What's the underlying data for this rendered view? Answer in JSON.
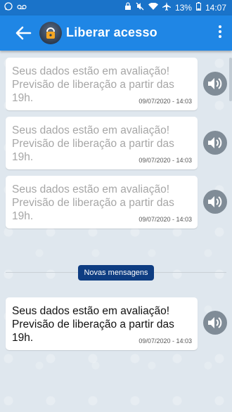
{
  "status_bar": {
    "battery": "13%",
    "time": "14:07"
  },
  "app_bar": {
    "title": "Liberar acesso"
  },
  "messages": [
    {
      "text": "Seus dados estão em avaliação! Previsão de liberação a partir das 19h.",
      "timestamp": "09/07/2020 - 14:03",
      "read": true
    },
    {
      "text": "Seus dados estão em avaliação! Previsão de liberação a partir das 19h.",
      "timestamp": "09/07/2020 - 14:03",
      "read": true
    },
    {
      "text": "Seus dados estão em avaliação! Previsão de liberação a partir das 19h.",
      "timestamp": "09/07/2020 - 14:03",
      "read": true
    },
    {
      "text": "Seus dados estão em avaliação! Previsão de liberação a partir das 19h.",
      "timestamp": "09/07/2020 - 14:03",
      "read": false
    }
  ],
  "new_messages_label": "Novas mensagens",
  "colors": {
    "status_bar": "#1a73c9",
    "app_bar": "#1f86e5",
    "chat_background": "#dfe7ee",
    "badge": "#0e3d82",
    "speaker_button": "#808c97"
  },
  "icons": {
    "back": "arrow-left-icon",
    "menu": "more-vertical-icon",
    "play_audio": "speaker-icon"
  }
}
